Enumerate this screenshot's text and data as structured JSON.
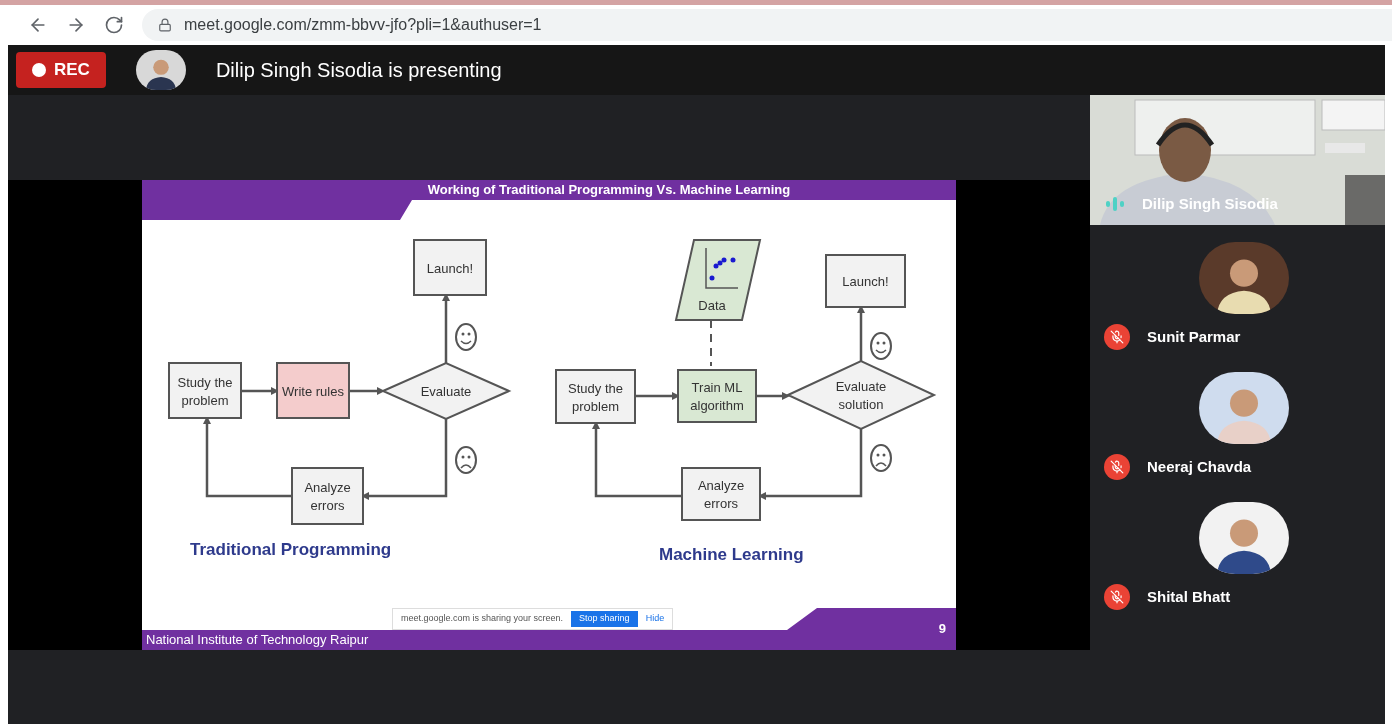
{
  "browser": {
    "url": "meet.google.com/zmm-bbvv-jfo?pli=1&authuser=1"
  },
  "meeting": {
    "recording": true,
    "rec_label": "REC",
    "presenter_banner": "Dilip Singh Sisodia is presenting"
  },
  "slide": {
    "title": "Working of Traditional Programming Vs. Machine Learning",
    "footer": "National Institute of Technology Raipur",
    "page_number": "9",
    "diagrams": [
      {
        "heading": "Traditional Programming",
        "nodes": [
          {
            "kind": "process",
            "lines": [
              "Launch!"
            ],
            "color": "#f2f2f2"
          },
          {
            "kind": "process",
            "lines": [
              "Study the",
              "problem"
            ],
            "color": "#f2f2f2"
          },
          {
            "kind": "process",
            "lines": [
              "Write rules"
            ],
            "color": "#f4cccc"
          },
          {
            "kind": "decision",
            "lines": [
              "Evaluate"
            ],
            "color": "#f2f2f2"
          },
          {
            "kind": "process",
            "lines": [
              "Analyze",
              "errors"
            ],
            "color": "#f2f2f2"
          }
        ]
      },
      {
        "heading": "Machine Learning",
        "nodes": [
          {
            "kind": "data",
            "lines": [
              "Data"
            ],
            "color": "#d9e8d3"
          },
          {
            "kind": "process",
            "lines": [
              "Launch!"
            ],
            "color": "#f2f2f2"
          },
          {
            "kind": "process",
            "lines": [
              "Study the",
              "problem"
            ],
            "color": "#f2f2f2"
          },
          {
            "kind": "process",
            "lines": [
              "Train ML",
              "algorithm"
            ],
            "color": "#d9e8d3"
          },
          {
            "kind": "decision",
            "lines": [
              "Evaluate",
              "solution"
            ],
            "color": "#f2f2f2"
          },
          {
            "kind": "process",
            "lines": [
              "Analyze",
              "errors"
            ],
            "color": "#f2f2f2"
          }
        ]
      }
    ],
    "share_bar": {
      "message": "meet.google.com is sharing your screen.",
      "stop_button": "Stop sharing",
      "hide_button": "Hide"
    }
  },
  "participants": [
    {
      "name": "Dilip Singh Sisodia",
      "kind": "video",
      "muted": false
    },
    {
      "name": "Sunit Parmar",
      "kind": "avatar",
      "muted": true
    },
    {
      "name": "Neeraj Chavda",
      "kind": "avatar",
      "muted": true
    },
    {
      "name": "Shital Bhatt",
      "kind": "avatar",
      "muted": true
    }
  ]
}
